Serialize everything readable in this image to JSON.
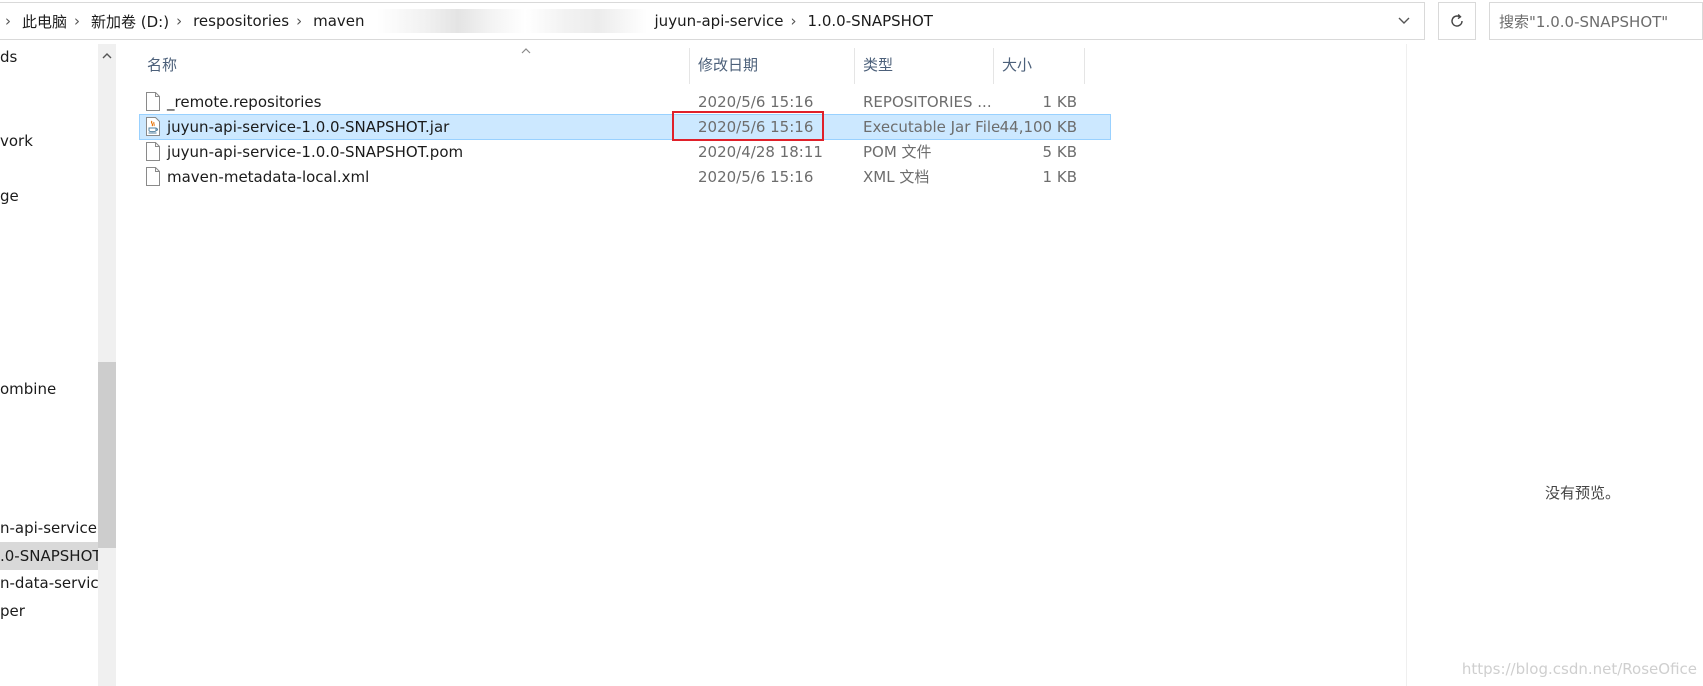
{
  "address_bar": {
    "crumbs": [
      "此电脑",
      "新加卷 (D:)",
      "respositories",
      "maven",
      "juyun-api-service",
      "1.0.0-SNAPSHOT"
    ]
  },
  "search": {
    "placeholder": "搜索\"1.0.0-SNAPSHOT\""
  },
  "nav_pane": {
    "items": [
      {
        "label": "ds"
      },
      {
        "label": "vork"
      },
      {
        "label": "ge"
      },
      {
        "label": "ombine"
      },
      {
        "label": "n-api-service"
      },
      {
        "label": ".0-SNAPSHOT"
      },
      {
        "label": "n-data-service"
      },
      {
        "label": "per"
      }
    ],
    "selected_index": 5
  },
  "columns": {
    "name": "名称",
    "modified": "修改日期",
    "type": "类型",
    "size": "大小"
  },
  "files": [
    {
      "name": "_remote.repositories",
      "modified": "2020/5/6 15:16",
      "type": "REPOSITORIES ...",
      "size": "1 KB",
      "icon": "generic-file-icon"
    },
    {
      "name": "juyun-api-service-1.0.0-SNAPSHOT.jar",
      "modified": "2020/5/6 15:16",
      "type": "Executable Jar File",
      "size": "44,100 KB",
      "icon": "java-jar-icon"
    },
    {
      "name": "juyun-api-service-1.0.0-SNAPSHOT.pom",
      "modified": "2020/4/28 18:11",
      "type": "POM 文件",
      "size": "5 KB",
      "icon": "generic-file-icon"
    },
    {
      "name": "maven-metadata-local.xml",
      "modified": "2020/5/6 15:16",
      "type": "XML 文档",
      "size": "1 KB",
      "icon": "generic-file-icon"
    }
  ],
  "selected_file_index": 1,
  "preview": {
    "empty_text": "没有预览。"
  },
  "watermark": "https://blog.csdn.net/RoseOfice",
  "colors": {
    "selection_bg": "#cce8ff",
    "selection_border": "#99d1ff",
    "highlight_red": "#e0202a",
    "header_text": "#4c607a"
  }
}
